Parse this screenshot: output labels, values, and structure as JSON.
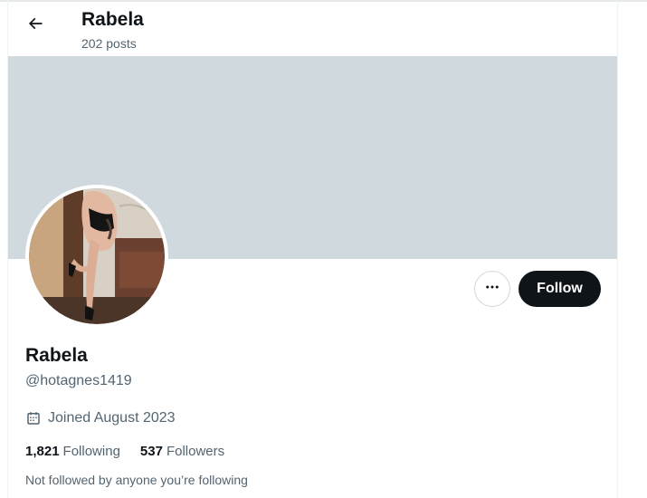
{
  "header": {
    "title": "Rabela",
    "post_count": "202 posts",
    "back_icon": "arrow-left-icon"
  },
  "banner": {
    "color": "#cfd9de"
  },
  "profile": {
    "display_name": "Rabela",
    "handle": "@hotagnes1419",
    "joined": "Joined August 2023",
    "joined_icon": "calendar-icon",
    "following_count": "1,821",
    "following_label": "Following",
    "followers_count": "537",
    "followers_label": "Followers",
    "not_followed_text": "Not followed by anyone you’re following"
  },
  "actions": {
    "more_icon": "more-dots-icon",
    "follow_label": "Follow"
  },
  "colors": {
    "primary_text": "#0f1419",
    "secondary_text": "#536471",
    "follow_button_bg": "#0f1419",
    "border": "#cfd9de"
  }
}
